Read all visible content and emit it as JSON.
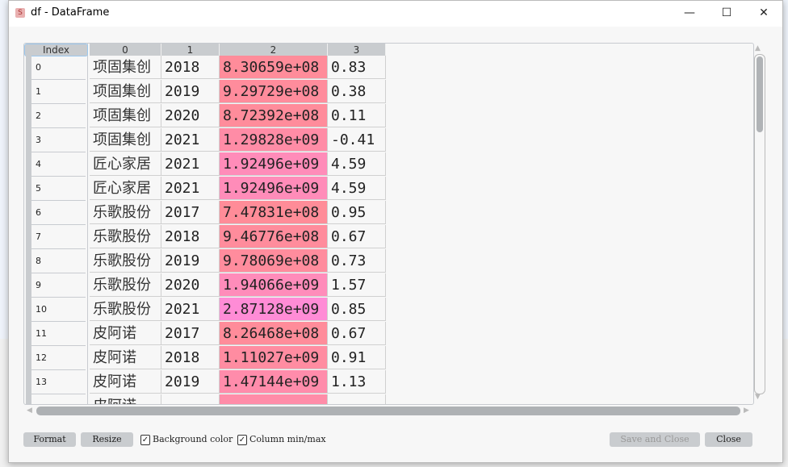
{
  "window": {
    "title": "df - DataFrame",
    "minimize": "—",
    "maximize": "☐",
    "close": "✕",
    "icon": "spyder-icon"
  },
  "table": {
    "index_header": "Index",
    "columns": [
      "0",
      "1",
      "2",
      "3"
    ],
    "rows": [
      {
        "i": "0",
        "c0": "项固集创",
        "c1": "2018",
        "c2": "8.30659e+08",
        "c3": "0.83",
        "bg": "#ff8c9a"
      },
      {
        "i": "1",
        "c0": "项固集创",
        "c1": "2019",
        "c2": "9.29729e+08",
        "c3": "0.38",
        "bg": "#ff8c9c"
      },
      {
        "i": "2",
        "c0": "项固集创",
        "c1": "2020",
        "c2": "8.72392e+08",
        "c3": "0.11",
        "bg": "#ff8c9b"
      },
      {
        "i": "3",
        "c0": "项固集创",
        "c1": "2021",
        "c2": "1.29828e+09",
        "c3": "-0.41",
        "bg": "#ff8ca6"
      },
      {
        "i": "4",
        "c0": "匠心家居",
        "c1": "2021",
        "c2": "1.92496e+09",
        "c3": "4.59",
        "bg": "#ff8cb9"
      },
      {
        "i": "5",
        "c0": "匠心家居",
        "c1": "2021",
        "c2": "1.92496e+09",
        "c3": "4.59",
        "bg": "#ff8cb9"
      },
      {
        "i": "6",
        "c0": "乐歌股份",
        "c1": "2017",
        "c2": "7.47831e+08",
        "c3": "0.95",
        "bg": "#ff8c98"
      },
      {
        "i": "7",
        "c0": "乐歌股份",
        "c1": "2018",
        "c2": "9.46776e+08",
        "c3": "0.67",
        "bg": "#ff8c9c"
      },
      {
        "i": "8",
        "c0": "乐歌股份",
        "c1": "2019",
        "c2": "9.78069e+08",
        "c3": "0.73",
        "bg": "#ff8c9d"
      },
      {
        "i": "9",
        "c0": "乐歌股份",
        "c1": "2020",
        "c2": "1.94066e+09",
        "c3": "1.57",
        "bg": "#ff8cba"
      },
      {
        "i": "10",
        "c0": "乐歌股份",
        "c1": "2021",
        "c2": "2.87128e+09",
        "c3": "0.85",
        "bg": "#ff8cd6"
      },
      {
        "i": "11",
        "c0": "皮阿诺",
        "c1": "2017",
        "c2": "8.26468e+08",
        "c3": "0.67",
        "bg": "#ff8c9a"
      },
      {
        "i": "12",
        "c0": "皮阿诺",
        "c1": "2018",
        "c2": "1.11027e+09",
        "c3": "0.91",
        "bg": "#ff8ca1"
      },
      {
        "i": "13",
        "c0": "皮阿诺",
        "c1": "2019",
        "c2": "1.47144e+09",
        "c3": "1.13",
        "bg": "#ff8cab"
      },
      {
        "i": "",
        "c0": "皮阿诺",
        "c1": "",
        "c2": "",
        "c3": "",
        "bg": "#ff8ca8"
      }
    ]
  },
  "footer": {
    "format": "Format",
    "resize": "Resize",
    "bg_color": "Background color",
    "col_minmax": "Column min/max",
    "save_close": "Save and Close",
    "close": "Close"
  }
}
